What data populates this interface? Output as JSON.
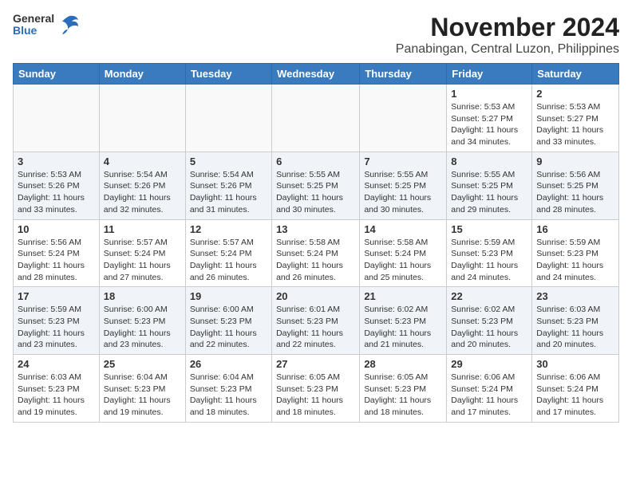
{
  "header": {
    "logo_general": "General",
    "logo_blue": "Blue",
    "title": "November 2024",
    "subtitle": "Panabingan, Central Luzon, Philippines"
  },
  "calendar": {
    "weekdays": [
      "Sunday",
      "Monday",
      "Tuesday",
      "Wednesday",
      "Thursday",
      "Friday",
      "Saturday"
    ],
    "rows": [
      [
        {
          "day": "",
          "info": ""
        },
        {
          "day": "",
          "info": ""
        },
        {
          "day": "",
          "info": ""
        },
        {
          "day": "",
          "info": ""
        },
        {
          "day": "",
          "info": ""
        },
        {
          "day": "1",
          "info": "Sunrise: 5:53 AM\nSunset: 5:27 PM\nDaylight: 11 hours\nand 34 minutes."
        },
        {
          "day": "2",
          "info": "Sunrise: 5:53 AM\nSunset: 5:27 PM\nDaylight: 11 hours\nand 33 minutes."
        }
      ],
      [
        {
          "day": "3",
          "info": "Sunrise: 5:53 AM\nSunset: 5:26 PM\nDaylight: 11 hours\nand 33 minutes."
        },
        {
          "day": "4",
          "info": "Sunrise: 5:54 AM\nSunset: 5:26 PM\nDaylight: 11 hours\nand 32 minutes."
        },
        {
          "day": "5",
          "info": "Sunrise: 5:54 AM\nSunset: 5:26 PM\nDaylight: 11 hours\nand 31 minutes."
        },
        {
          "day": "6",
          "info": "Sunrise: 5:55 AM\nSunset: 5:25 PM\nDaylight: 11 hours\nand 30 minutes."
        },
        {
          "day": "7",
          "info": "Sunrise: 5:55 AM\nSunset: 5:25 PM\nDaylight: 11 hours\nand 30 minutes."
        },
        {
          "day": "8",
          "info": "Sunrise: 5:55 AM\nSunset: 5:25 PM\nDaylight: 11 hours\nand 29 minutes."
        },
        {
          "day": "9",
          "info": "Sunrise: 5:56 AM\nSunset: 5:25 PM\nDaylight: 11 hours\nand 28 minutes."
        }
      ],
      [
        {
          "day": "10",
          "info": "Sunrise: 5:56 AM\nSunset: 5:24 PM\nDaylight: 11 hours\nand 28 minutes."
        },
        {
          "day": "11",
          "info": "Sunrise: 5:57 AM\nSunset: 5:24 PM\nDaylight: 11 hours\nand 27 minutes."
        },
        {
          "day": "12",
          "info": "Sunrise: 5:57 AM\nSunset: 5:24 PM\nDaylight: 11 hours\nand 26 minutes."
        },
        {
          "day": "13",
          "info": "Sunrise: 5:58 AM\nSunset: 5:24 PM\nDaylight: 11 hours\nand 26 minutes."
        },
        {
          "day": "14",
          "info": "Sunrise: 5:58 AM\nSunset: 5:24 PM\nDaylight: 11 hours\nand 25 minutes."
        },
        {
          "day": "15",
          "info": "Sunrise: 5:59 AM\nSunset: 5:23 PM\nDaylight: 11 hours\nand 24 minutes."
        },
        {
          "day": "16",
          "info": "Sunrise: 5:59 AM\nSunset: 5:23 PM\nDaylight: 11 hours\nand 24 minutes."
        }
      ],
      [
        {
          "day": "17",
          "info": "Sunrise: 5:59 AM\nSunset: 5:23 PM\nDaylight: 11 hours\nand 23 minutes."
        },
        {
          "day": "18",
          "info": "Sunrise: 6:00 AM\nSunset: 5:23 PM\nDaylight: 11 hours\nand 23 minutes."
        },
        {
          "day": "19",
          "info": "Sunrise: 6:00 AM\nSunset: 5:23 PM\nDaylight: 11 hours\nand 22 minutes."
        },
        {
          "day": "20",
          "info": "Sunrise: 6:01 AM\nSunset: 5:23 PM\nDaylight: 11 hours\nand 22 minutes."
        },
        {
          "day": "21",
          "info": "Sunrise: 6:02 AM\nSunset: 5:23 PM\nDaylight: 11 hours\nand 21 minutes."
        },
        {
          "day": "22",
          "info": "Sunrise: 6:02 AM\nSunset: 5:23 PM\nDaylight: 11 hours\nand 20 minutes."
        },
        {
          "day": "23",
          "info": "Sunrise: 6:03 AM\nSunset: 5:23 PM\nDaylight: 11 hours\nand 20 minutes."
        }
      ],
      [
        {
          "day": "24",
          "info": "Sunrise: 6:03 AM\nSunset: 5:23 PM\nDaylight: 11 hours\nand 19 minutes."
        },
        {
          "day": "25",
          "info": "Sunrise: 6:04 AM\nSunset: 5:23 PM\nDaylight: 11 hours\nand 19 minutes."
        },
        {
          "day": "26",
          "info": "Sunrise: 6:04 AM\nSunset: 5:23 PM\nDaylight: 11 hours\nand 18 minutes."
        },
        {
          "day": "27",
          "info": "Sunrise: 6:05 AM\nSunset: 5:23 PM\nDaylight: 11 hours\nand 18 minutes."
        },
        {
          "day": "28",
          "info": "Sunrise: 6:05 AM\nSunset: 5:23 PM\nDaylight: 11 hours\nand 18 minutes."
        },
        {
          "day": "29",
          "info": "Sunrise: 6:06 AM\nSunset: 5:24 PM\nDaylight: 11 hours\nand 17 minutes."
        },
        {
          "day": "30",
          "info": "Sunrise: 6:06 AM\nSunset: 5:24 PM\nDaylight: 11 hours\nand 17 minutes."
        }
      ]
    ]
  }
}
